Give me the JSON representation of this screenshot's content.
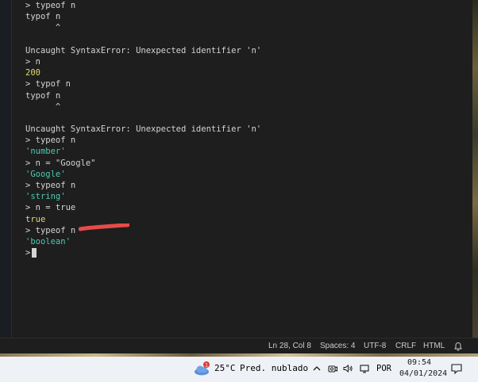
{
  "terminal": {
    "lines": [
      {
        "text": "> typeof n",
        "kind": "input"
      },
      {
        "text": "typof n",
        "kind": "plain"
      },
      {
        "text": "      ^",
        "kind": "plain"
      },
      {
        "text": "",
        "kind": "plain"
      },
      {
        "text": "Uncaught SyntaxError: Unexpected identifier 'n'",
        "kind": "err"
      },
      {
        "text": "> n",
        "kind": "input"
      },
      {
        "text": "200",
        "kind": "num"
      },
      {
        "text": "> typof n",
        "kind": "input"
      },
      {
        "text": "typof n",
        "kind": "plain"
      },
      {
        "text": "      ^",
        "kind": "plain"
      },
      {
        "text": "",
        "kind": "plain"
      },
      {
        "text": "Uncaught SyntaxError: Unexpected identifier 'n'",
        "kind": "err"
      },
      {
        "text": "> typeof n",
        "kind": "input"
      },
      {
        "text": "'number'",
        "kind": "str"
      },
      {
        "text": "> n = \"Google\"",
        "kind": "input"
      },
      {
        "text": "'Google'",
        "kind": "str"
      },
      {
        "text": "> typeof n",
        "kind": "input"
      },
      {
        "text": "'string'",
        "kind": "str"
      },
      {
        "text": "> n = true",
        "kind": "input"
      },
      {
        "text": "true",
        "kind": "bool"
      },
      {
        "text": "> typeof n",
        "kind": "input"
      },
      {
        "text": "'boolean'",
        "kind": "str"
      }
    ],
    "prompt": ">"
  },
  "statusbar": {
    "position": "Ln 28, Col 8",
    "spaces": "Spaces: 4",
    "encoding": "UTF-8",
    "eol": "CRLF",
    "language": "HTML"
  },
  "taskbar": {
    "weather_badge": "1",
    "temperature": "25°C",
    "weather_text": "Pred. nublado",
    "language": "POR",
    "time": "09:54",
    "date": "04/01/2024"
  },
  "colors": {
    "string": "#4ec9b0",
    "number": "#dcdc6e",
    "annotation": "#e84a4a"
  },
  "icons": [
    "chevron-up-icon",
    "camera-icon",
    "speaker-icon",
    "monitor-icon",
    "bell-icon",
    "notification-icon",
    "weather-cloud-icon"
  ]
}
